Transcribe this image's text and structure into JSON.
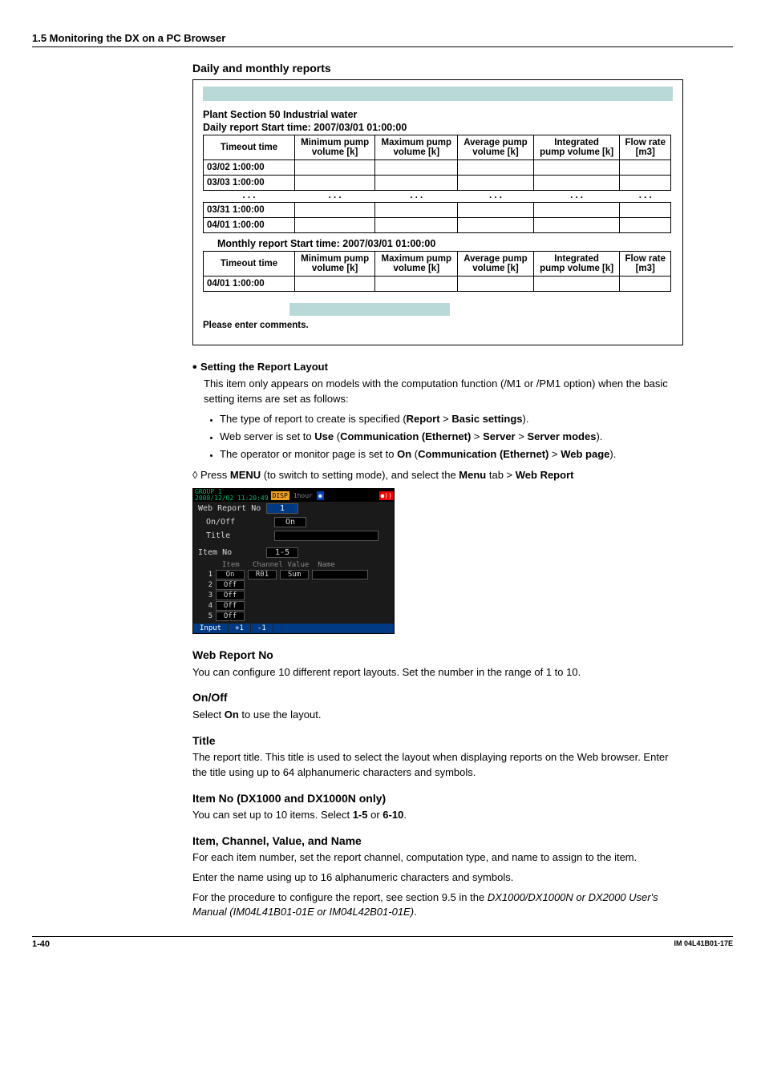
{
  "header": {
    "section": "1.5  Monitoring the DX on a PC Browser"
  },
  "subtitle": "Daily and monthly reports",
  "illustration": {
    "plant": "Plant  Section 50  Industrial water",
    "daily": "Daily report  Start time: 2007/03/01 01:00:00",
    "monthly": "Monthly report  Start time: 2007/03/01 01:00:00",
    "columns": {
      "c0": "Timeout time",
      "c1a": "Minimum pump",
      "c1b": "volume [k]",
      "c2a": "Maximum pump",
      "c2b": "volume [k]",
      "c3a": "Average pump",
      "c3b": "volume [k]",
      "c4a": "Integrated",
      "c4b": "pump volume [k]",
      "c5a": "Flow rate",
      "c5b": "[m3]"
    },
    "daily_rows": {
      "r1": "03/02 1:00:00",
      "r2": "03/03 1:00:00",
      "dots": ". . .",
      "r3": "03/31 1:00:00",
      "r4": "04/01 1:00:00"
    },
    "monthly_rows": {
      "r1": "04/01 1:00:00"
    },
    "comments": "Please enter comments."
  },
  "setting_layout": {
    "h": "Setting the Report Layout",
    "p1a": "This item only appears on models with the computation function (/M1 or /PM1 option) when the basic setting items are set as follows:",
    "b1a": "The type of report to create is specified (",
    "b1b": "Report",
    "b1c": " > ",
    "b1d": "Basic settings",
    "b1e": ").",
    "b2a": "Web server is set to ",
    "b2b": "Use",
    "b2c": " (",
    "b2d": "Communication (Ethernet)",
    "b2e": " > ",
    "b2f": "Server",
    "b2g": " > ",
    "b2h": "Server modes",
    "b2i": ").",
    "b3a": "The operator or monitor page is set to ",
    "b3b": "On",
    "b3c": " (",
    "b3d": "Communication (Ethernet)",
    "b3e": " > ",
    "b3f": "Web page",
    "b3g": ").",
    "menu_a": "◊ Press ",
    "menu_b": "MENU",
    "menu_c": " (to switch to setting mode), and select the ",
    "menu_d": "Menu",
    "menu_e": " tab > ",
    "menu_f": "Web Report"
  },
  "screenshot": {
    "group": "GROUP 1",
    "ts": "2008/12/02 11:20:49",
    "disp": "DISP",
    "mode": "1hour",
    "lbl_no": "Web Report No",
    "val_no": "1",
    "lbl_onoff": "On/Off",
    "val_onoff": "On",
    "lbl_title": "Title",
    "lbl_item": "Item No",
    "val_item": "1-5",
    "col_item": "Item",
    "col_ch": "Channel",
    "col_val": "Value",
    "col_name": "Name",
    "r1n": "1",
    "r1i": "On",
    "r1c": "R01",
    "r1v": "Sum",
    "r2n": "2",
    "r2i": "Off",
    "r3n": "3",
    "r3i": "Off",
    "r4n": "4",
    "r4i": "Off",
    "r5n": "5",
    "r5i": "Off",
    "f1": "Input",
    "f2": "+1",
    "f3": "-1"
  },
  "sections": {
    "wrn_h": "Web Report No",
    "wrn_p": "You can configure 10 different report layouts. Set the number in the range of 1 to 10.",
    "oo_h": "On/Off",
    "oo_a": "Select ",
    "oo_b": "On",
    "oo_c": " to use the layout.",
    "title_h": "Title",
    "title_p": "The report title. This title is used to select the layout when displaying reports on the Web browser. Enter the title using up to 64 alphanumeric characters and symbols.",
    "item_h": "Item No (DX1000 and DX1000N only)",
    "item_a": "You can set up to 10 items. Select ",
    "item_b": "1-5",
    "item_c": " or ",
    "item_d": "6-10",
    "item_e": ".",
    "icvn_h": "Item, Channel, Value, and Name",
    "icvn_p1": "For each item number, set the report channel, computation type, and name to assign to the item.",
    "icvn_p2": "Enter the name using up to 16 alphanumeric characters and symbols.",
    "icvn_p3a": "For the procedure to configure the report, see section 9.5 in the ",
    "icvn_p3b": "DX1000/DX1000N or DX2000 User's Manual (IM04L41B01-01E or IM04L42B01-01E)",
    "icvn_p3c": "."
  },
  "footer": {
    "page": "1-40",
    "doc": "IM 04L41B01-17E"
  }
}
